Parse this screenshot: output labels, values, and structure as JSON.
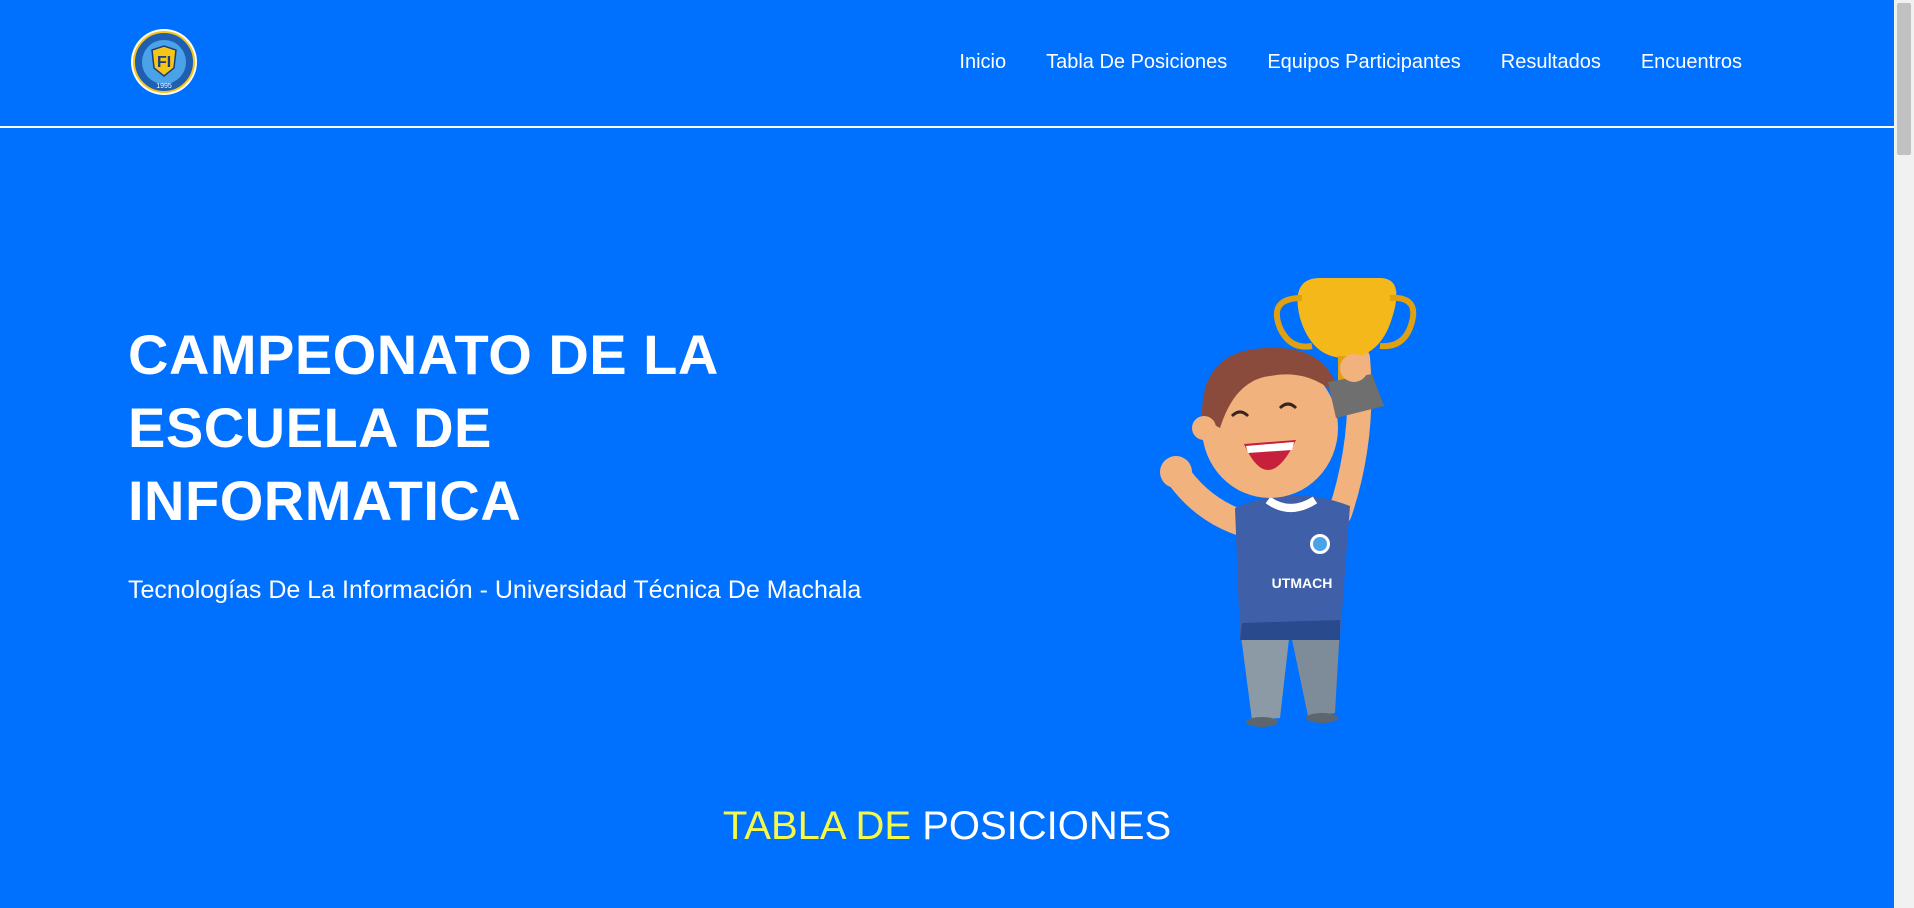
{
  "header": {
    "logo": {
      "icon": "club-crest-logo",
      "text": "1995"
    },
    "nav": [
      {
        "label": "Inicio"
      },
      {
        "label": "Tabla De Posiciones"
      },
      {
        "label": "Equipos Participantes"
      },
      {
        "label": "Resultados"
      },
      {
        "label": "Encuentros"
      }
    ]
  },
  "hero": {
    "title_lines": [
      "CAMPEONATO DE LA",
      "ESCUELA DE",
      "INFORMATICA"
    ],
    "subtitle": "Tecnologías De La Información - Universidad Técnica De Machala",
    "illustration": {
      "icon": "boy-holding-trophy-illustration",
      "shirt_text": "UTMACH"
    }
  },
  "section": {
    "title_highlight": "TABLA DE",
    "title_rest": "POSICIONES"
  },
  "colors": {
    "background": "#0070ff",
    "text": "#ffffff",
    "highlight": "#f4f94a",
    "trophy": "#f5b81a",
    "shirt": "#3f5fa8"
  }
}
